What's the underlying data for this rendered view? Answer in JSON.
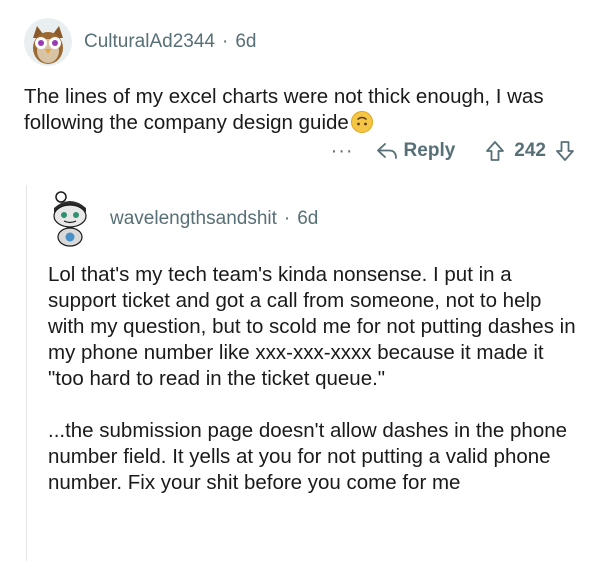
{
  "parent_comment": {
    "username": "CulturalAd2344",
    "separator": "·",
    "age": "6d",
    "text": "The lines of my excel charts were not thick enough, I was following the company design guide",
    "emoji_icon": "upside-down-face-emoji"
  },
  "actions": {
    "more_label": "···",
    "reply_label": "Reply",
    "vote_count": "242"
  },
  "reply_comment": {
    "username": "wavelengthsandshit",
    "separator": "·",
    "age": "6d",
    "paragraph_1": "Lol that's my tech team's kinda nonsense. I put in a support ticket and got a call from someone, not to help with my question, but to scold me for not putting dashes in my phone number like xxx-xxx-xxxx because it made it \"too hard to read in the ticket queue.\"",
    "paragraph_2": "...the submission page doesn't allow dashes in the phone number field. It yells at you for not putting a valid phone number. Fix your shit before you come for me"
  },
  "colors": {
    "text": "#1a1a1b",
    "meta": "#576f76",
    "emoji": "#f5c645"
  }
}
